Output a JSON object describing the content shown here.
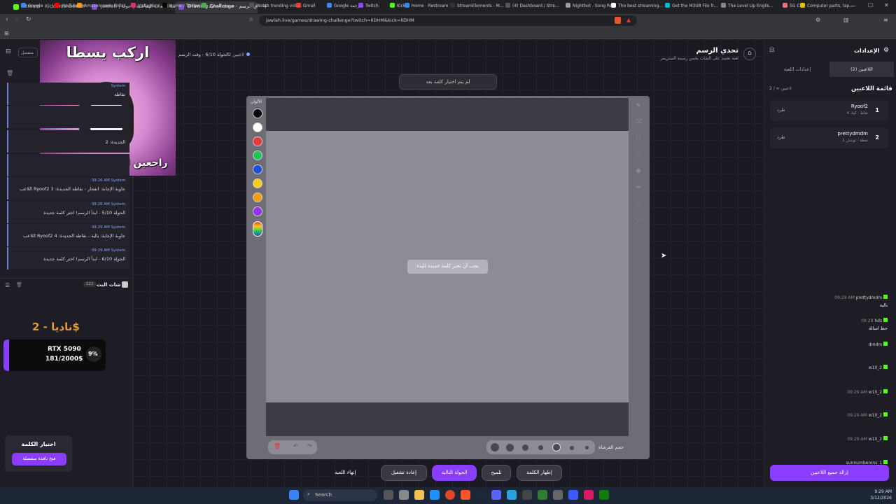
{
  "tabs": [
    {
      "label": "Stream - Kick Dashboard",
      "color": "#53fc18"
    },
    {
      "label": "Jawlah | منصة الألعاب التفاعلية | جولة",
      "color": "#7b4bd6"
    },
    {
      "label": "Drawing Challenge - تحدي الرسم",
      "color": "#7b4bd6"
    }
  ],
  "url": "jawlah.live/games/drawing-challenge?twitch=IIDHM&kick=IIDHM",
  "bookmarks": [
    "Google",
    "YouTube",
    "Amazon.com: Onlin...",
    "Instagram",
    "Home / Twitter",
    "تسجيل الدخول",
    "Watch trending vide...",
    "Gmail",
    "Google ترجمة",
    "Twitch",
    "Kick",
    "Home - Restream",
    "StreamElements - M...",
    "(4) Dashboard / Stre...",
    "Nightbot - Song Re...",
    "The best streaming...",
    "Get the M3U8 File fr...",
    "The Level Up Englis...",
    "5G CPE",
    "Computer parts, lap..."
  ],
  "left": {
    "disconnected": "منفصل",
    "system_rows": [
      {
        "meta": "System",
        "time": "",
        "text": "نقاطه"
      },
      {
        "meta": "",
        "time": "",
        "text": ""
      },
      {
        "meta": "",
        "time": "",
        "text": "الجديدة: 2"
      },
      {
        "meta": "",
        "time": "",
        "text": ""
      },
      {
        "meta": "System",
        "time": "09:26 AM",
        "text": "اللاعب Ryoof2 جاوبة الإجابة: انفجار - نقاطه الجديدة: 3"
      },
      {
        "meta": "System",
        "time": "09:26 AM",
        "text": "الجولة 5/10 - ابدأ الرسم! اختر كلمة جديدة"
      },
      {
        "meta": "System",
        "time": "09:29 AM",
        "text": "اللاعب Ryoof2 جاوبة الإجابة: بالية - نقاطه الجديدة: 4"
      },
      {
        "meta": "System",
        "time": "09:29 AM",
        "text": "الجولة 6/10 - ابدأ الرسم! اختر كلمة جديدة"
      }
    ],
    "live_chat_title": "شات البث",
    "live_count": "122",
    "chat": [
      {
        "name": "prettydmdm",
        "time": "09:28 AM",
        "msg": "بالية"
      },
      {
        "name": "hds",
        "time": "09:28",
        "msg": "حظ اسالة"
      },
      {
        "name": "dmdm",
        "time": "",
        "msg": ""
      },
      {
        "name": "w10_2",
        "time": "",
        "msg": ""
      },
      {
        "name": "w10_2",
        "time": "09:29 AM",
        "msg": ""
      },
      {
        "name": "w10_2",
        "time": "09:29 AM",
        "msg": ""
      },
      {
        "name": "w10_2",
        "time": "09:29 AM",
        "msg": ""
      },
      {
        "name": "sunnumberons_1",
        "time": "",
        "msg": ""
      }
    ],
    "donation_name": "ناديا - 2$",
    "goal_title": "RTX 5090",
    "goal_progress": "181/2000$",
    "goal_percent": "9%",
    "overlay_top_text": "اركب يسطا",
    "overlay_bottom_text": "راجعين لنعيم الجهل تاني",
    "choose_word_title": "اختيار الكلمة",
    "open_window_button": "فتح نافذة منفصلة"
  },
  "header": {
    "title": "تحدي الرسم",
    "subtitle": "لعبة تعتمد على الشات يخمن رسمة الستريمر",
    "round_info": "الجولة 6/10 - وقت الرسم",
    "players_count": "2 لاعبين"
  },
  "center": {
    "no_word_banner": "لم يتم اختيار كلمة بعد",
    "colors_label": "الألوان",
    "must_choose_word": "يجب أن تختر كلمة جديدة للبدء",
    "brush_size_label": "حجم الفرشاة",
    "colors": [
      "#000000",
      "#ffffff",
      "#e53935",
      "#22c55e",
      "#1d4ed8",
      "#facc15",
      "#f59e0b",
      "#9333ea"
    ],
    "buttons": {
      "show_word": "إظهار الكلمة",
      "hint": "تلميح",
      "next_round": "الجولة التالية",
      "restart": "إعادة تشغيل",
      "end_game": "إنهاء اللعبة"
    }
  },
  "right": {
    "settings_title": "الإعدادات",
    "tab_players": "اللاعبين (2)",
    "tab_game_settings": "إعدادات اللعبة",
    "players_list_title": "قائمة اللاعبين",
    "players_count": "2 / ∞ لاعبين",
    "players": [
      {
        "rank": "1",
        "name": "Ryoof2",
        "platform": "كيك",
        "points": "4 نقاط",
        "kick_label": "طرد"
      },
      {
        "rank": "2",
        "name": "prettydmdm",
        "platform": "تويتش",
        "points": "1 نقطة",
        "kick_label": "طرد"
      }
    ],
    "remove_all_button": "إزالة جميع اللاعبين"
  },
  "taskbar": {
    "search": "Search",
    "time": "9:29 AM",
    "date": "3/12/2026"
  }
}
